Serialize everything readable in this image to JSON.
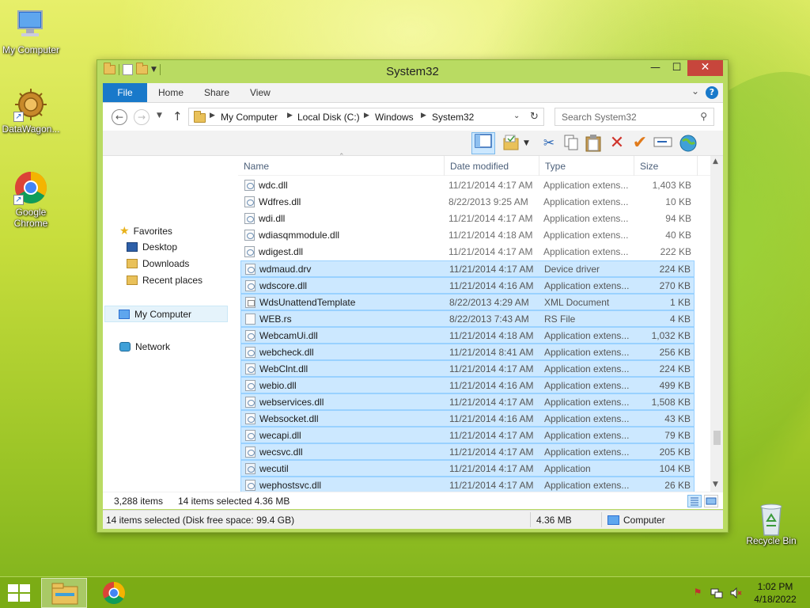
{
  "desktop": {
    "icons": [
      {
        "label": "My Computer"
      },
      {
        "label": "DataWagon..."
      },
      {
        "label": "Google Chrome"
      },
      {
        "label": "Recycle Bin"
      }
    ]
  },
  "window": {
    "title": "System32",
    "controls": {
      "minimize": "—",
      "maximize": "☐",
      "close": "✕"
    },
    "ribbon_tabs": [
      "File",
      "Home",
      "Share",
      "View"
    ],
    "help": "?",
    "address": {
      "crumbs": [
        "My Computer",
        "Local Disk (C:)",
        "Windows",
        "System32"
      ]
    },
    "search": {
      "placeholder": "Search System32"
    },
    "nav_pane": {
      "favorites_label": "Favorites",
      "favorites": [
        "Desktop",
        "Downloads",
        "Recent places"
      ],
      "my_computer": "My Computer",
      "network": "Network"
    },
    "columns": [
      "Name",
      "Date modified",
      "Type",
      "Size"
    ],
    "files": [
      {
        "name": "wdc.dll",
        "date": "11/21/2014 4:17 AM",
        "type": "Application extens...",
        "size": "1,403 KB",
        "icon": "dll",
        "selected": false
      },
      {
        "name": "Wdfres.dll",
        "date": "8/22/2013 9:25 AM",
        "type": "Application extens...",
        "size": "10 KB",
        "icon": "dll",
        "selected": false
      },
      {
        "name": "wdi.dll",
        "date": "11/21/2014 4:17 AM",
        "type": "Application extens...",
        "size": "94 KB",
        "icon": "dll",
        "selected": false
      },
      {
        "name": "wdiasqmmodule.dll",
        "date": "11/21/2014 4:18 AM",
        "type": "Application extens...",
        "size": "40 KB",
        "icon": "dll",
        "selected": false
      },
      {
        "name": "wdigest.dll",
        "date": "11/21/2014 4:17 AM",
        "type": "Application extens...",
        "size": "222 KB",
        "icon": "dll",
        "selected": false
      },
      {
        "name": "wdmaud.drv",
        "date": "11/21/2014 4:17 AM",
        "type": "Device driver",
        "size": "224 KB",
        "icon": "dll",
        "selected": true
      },
      {
        "name": "wdscore.dll",
        "date": "11/21/2014 4:16 AM",
        "type": "Application extens...",
        "size": "270 KB",
        "icon": "dll",
        "selected": true
      },
      {
        "name": "WdsUnattendTemplate",
        "date": "8/22/2013 4:29 AM",
        "type": "XML Document",
        "size": "1 KB",
        "icon": "xml",
        "selected": true
      },
      {
        "name": "WEB.rs",
        "date": "8/22/2013 7:43 AM",
        "type": "RS File",
        "size": "4 KB",
        "icon": "blank",
        "selected": true
      },
      {
        "name": "WebcamUi.dll",
        "date": "11/21/2014 4:18 AM",
        "type": "Application extens...",
        "size": "1,032 KB",
        "icon": "dll",
        "selected": true
      },
      {
        "name": "webcheck.dll",
        "date": "11/21/2014 8:41 AM",
        "type": "Application extens...",
        "size": "256 KB",
        "icon": "dll",
        "selected": true
      },
      {
        "name": "WebClnt.dll",
        "date": "11/21/2014 4:17 AM",
        "type": "Application extens...",
        "size": "224 KB",
        "icon": "dll",
        "selected": true
      },
      {
        "name": "webio.dll",
        "date": "11/21/2014 4:16 AM",
        "type": "Application extens...",
        "size": "499 KB",
        "icon": "dll",
        "selected": true
      },
      {
        "name": "webservices.dll",
        "date": "11/21/2014 4:17 AM",
        "type": "Application extens...",
        "size": "1,508 KB",
        "icon": "dll",
        "selected": true
      },
      {
        "name": "Websocket.dll",
        "date": "11/21/2014 4:16 AM",
        "type": "Application extens...",
        "size": "43 KB",
        "icon": "dll",
        "selected": true
      },
      {
        "name": "wecapi.dll",
        "date": "11/21/2014 4:17 AM",
        "type": "Application extens...",
        "size": "79 KB",
        "icon": "dll",
        "selected": true
      },
      {
        "name": "wecsvc.dll",
        "date": "11/21/2014 4:17 AM",
        "type": "Application extens...",
        "size": "205 KB",
        "icon": "dll",
        "selected": true
      },
      {
        "name": "wecutil",
        "date": "11/21/2014 4:17 AM",
        "type": "Application",
        "size": "104 KB",
        "icon": "exe",
        "selected": true
      },
      {
        "name": "wephostsvc.dll",
        "date": "11/21/2014 4:17 AM",
        "type": "Application extens...",
        "size": "26 KB",
        "icon": "dll",
        "selected": true
      }
    ],
    "status": {
      "item_count": "3,288 items",
      "selected_info": "14 items selected  4.36 MB"
    },
    "status_bar": {
      "left": "14 items selected (Disk free space: 99.4 GB)",
      "size": "4.36 MB",
      "location": "Computer"
    }
  },
  "taskbar": {
    "clock_time": "1:02 PM",
    "clock_date": "4/18/2022"
  },
  "colors": {
    "accent": "#1979ca",
    "selection": "#cce8ff",
    "window_frame": "#b9db62"
  }
}
